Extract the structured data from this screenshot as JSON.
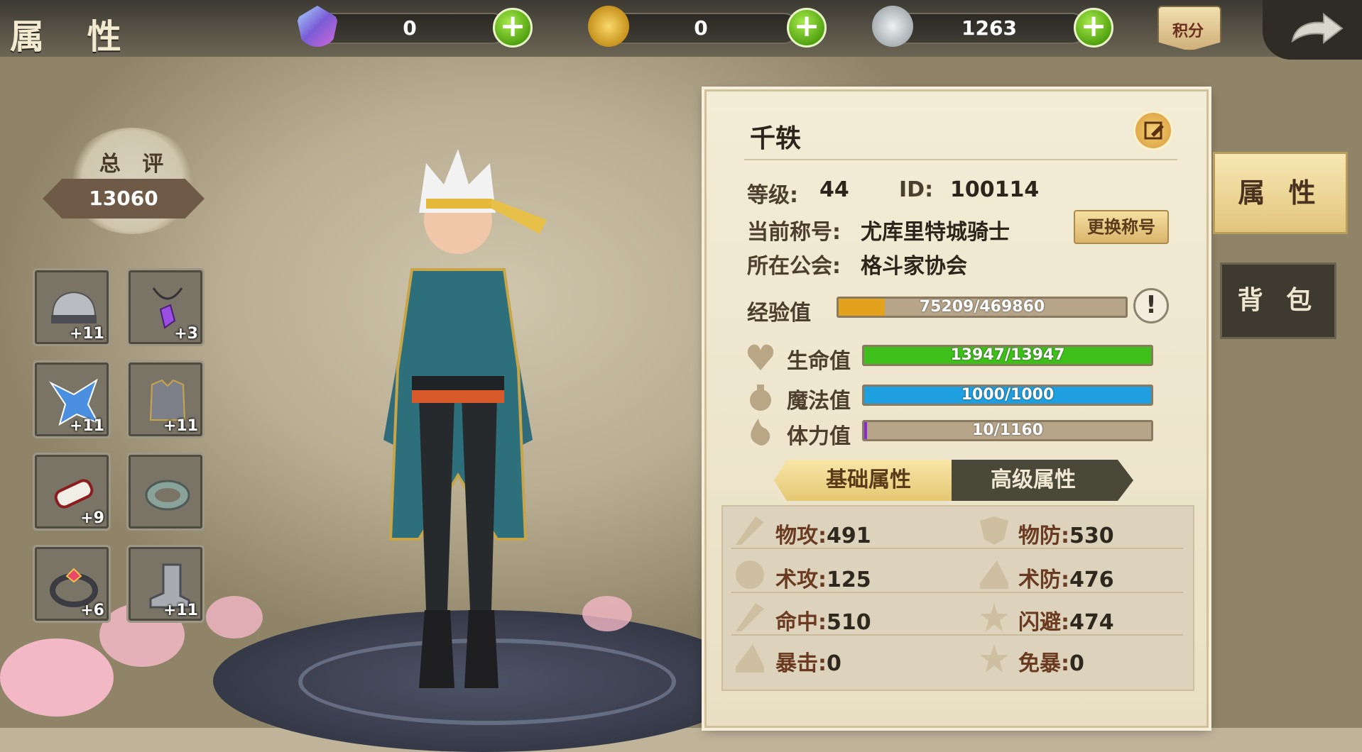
{
  "header": {
    "title": "属 性",
    "currencies": [
      {
        "icon": "gem-icon",
        "value": "0"
      },
      {
        "icon": "gold-coin-icon",
        "value": "0"
      },
      {
        "icon": "silver-coin-icon",
        "value": "1263"
      }
    ],
    "score_label": "积分"
  },
  "total_score": {
    "label": "总 评",
    "value": "13060"
  },
  "equipment": [
    {
      "name": "helmet",
      "level": "+11"
    },
    {
      "name": "necklace",
      "level": "+3"
    },
    {
      "name": "weapon",
      "level": "+11"
    },
    {
      "name": "armor",
      "level": "+11"
    },
    {
      "name": "bracer",
      "level": "+9"
    },
    {
      "name": "belt",
      "level": ""
    },
    {
      "name": "ring",
      "level": "+6"
    },
    {
      "name": "boots",
      "level": "+11"
    }
  ],
  "profile": {
    "name": "千轶",
    "level_label": "等级:",
    "level": "44",
    "id_label": "ID:",
    "id": "100114",
    "title_label": "当前称号:",
    "title": "尤库里特城骑士",
    "change_title": "更换称号",
    "guild_label": "所在公会:",
    "guild": "格斗家协会",
    "exp_label": "经验值",
    "exp_text": "75209/469860",
    "exp_fraction": 0.16
  },
  "vitals": [
    {
      "label": "生命值",
      "text": "13947/13947",
      "fraction": 1.0,
      "color": "#3fbf1a",
      "icon": "heart-icon"
    },
    {
      "label": "魔法值",
      "text": "1000/1000",
      "fraction": 1.0,
      "color": "#1d9fe0",
      "icon": "potion-icon"
    },
    {
      "label": "体力值",
      "text": "10/1160",
      "fraction": 0.009,
      "color": "#8d2ad6",
      "icon": "flame-icon"
    }
  ],
  "tabs": {
    "basic": "基础属性",
    "advanced": "高级属性"
  },
  "stats": [
    {
      "label": "物攻:",
      "value": "491"
    },
    {
      "label": "物防:",
      "value": "530"
    },
    {
      "label": "术攻:",
      "value": "125"
    },
    {
      "label": "术防:",
      "value": "476"
    },
    {
      "label": "命中:",
      "value": "510"
    },
    {
      "label": "闪避:",
      "value": "474"
    },
    {
      "label": "暴击:",
      "value": "0"
    },
    {
      "label": "免暴:",
      "value": "0"
    }
  ],
  "side_tabs": {
    "attributes": "属 性",
    "bag": "背 包"
  }
}
